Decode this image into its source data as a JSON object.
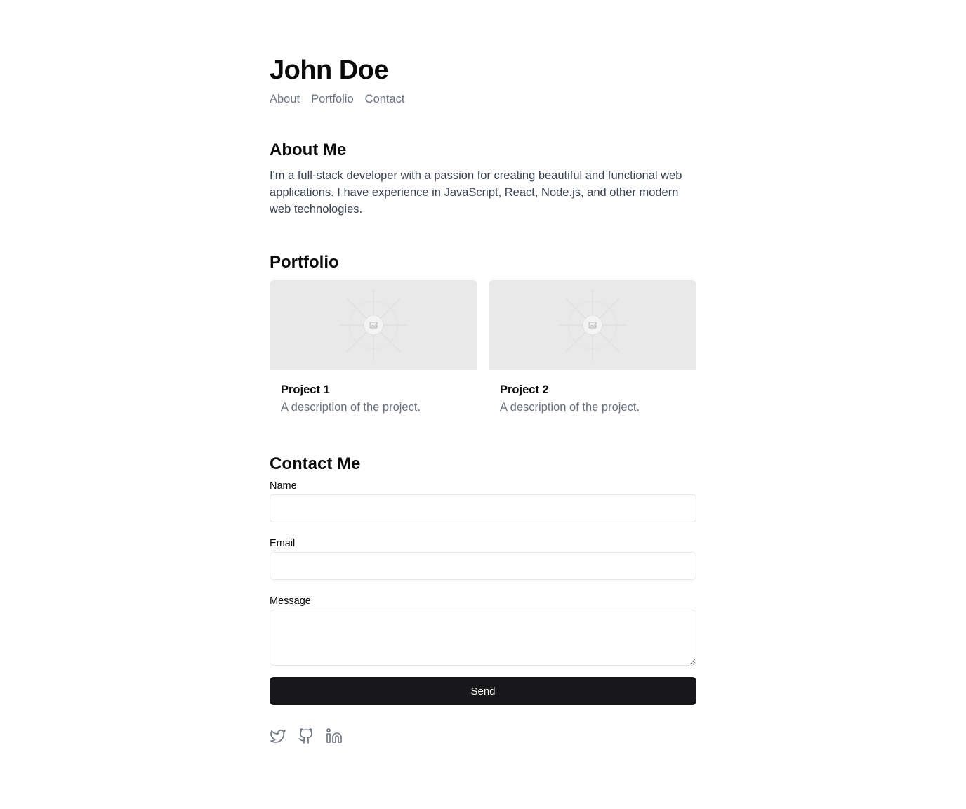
{
  "header": {
    "title": "John Doe",
    "nav": [
      "About",
      "Portfolio",
      "Contact"
    ]
  },
  "about": {
    "heading": "About Me",
    "text": "I'm a full-stack developer with a passion for creating beautiful and functional web applications. I have experience in JavaScript, React, Node.js, and other modern web technologies."
  },
  "portfolio": {
    "heading": "Portfolio",
    "projects": [
      {
        "title": "Project 1",
        "description": "A description of the project.",
        "image_icon": "image-placeholder-icon"
      },
      {
        "title": "Project 2",
        "description": "A description of the project.",
        "image_icon": "image-placeholder-icon"
      }
    ]
  },
  "contact": {
    "heading": "Contact Me",
    "name_label": "Name",
    "name_value": "",
    "email_label": "Email",
    "email_value": "",
    "message_label": "Message",
    "message_value": "",
    "send_label": "Send"
  },
  "social": [
    "twitter-icon",
    "github-icon",
    "linkedin-icon"
  ],
  "colors": {
    "button_bg": "#18181b",
    "muted_text": "#6b7280",
    "placeholder_bg": "#e9e9e9"
  }
}
